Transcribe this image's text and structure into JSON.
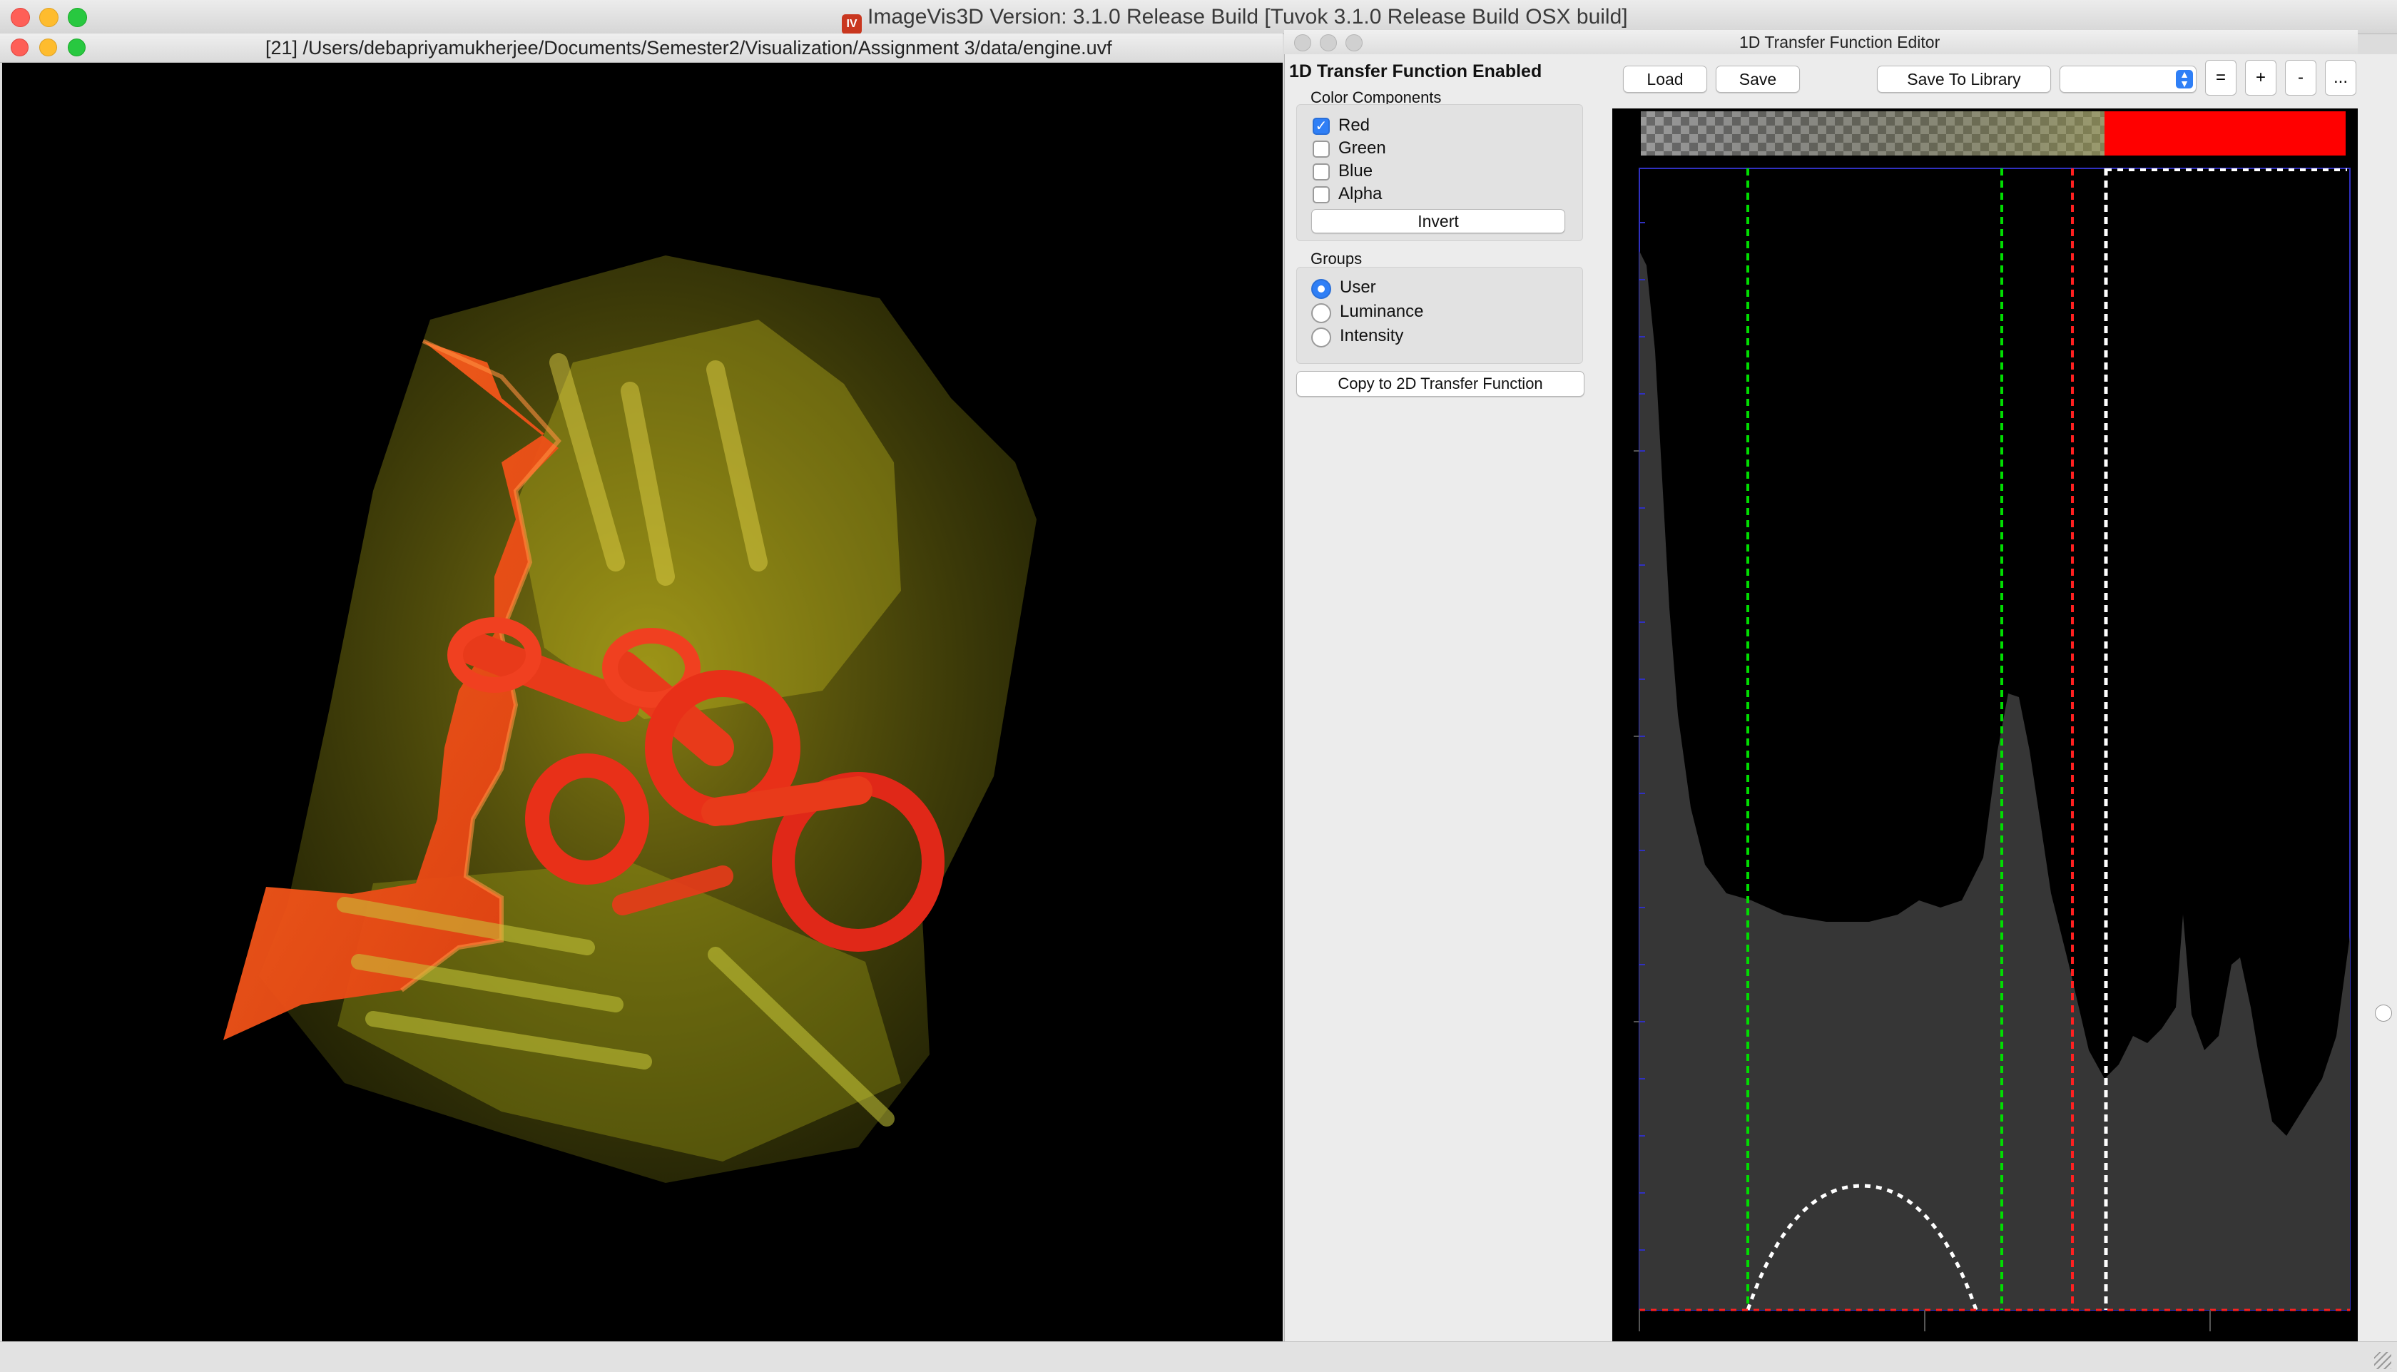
{
  "app": {
    "title": "ImageVis3D Version: 3.1.0 Release Build [Tuvok 3.1.0 Release Build OSX build]",
    "logo_text": "IV"
  },
  "render_window": {
    "title": "[21] /Users/debapriyamukherjee/Documents/Semester2/Visualization/Assignment 3/data/engine.uvf"
  },
  "editor_window": {
    "title": "1D Transfer Function Editor",
    "status": "1D Transfer Function Enabled",
    "color_components": {
      "heading": "Color Components",
      "items": [
        {
          "label": "Red",
          "checked": true
        },
        {
          "label": "Green",
          "checked": false
        },
        {
          "label": "Blue",
          "checked": false
        },
        {
          "label": "Alpha",
          "checked": false
        }
      ],
      "invert_label": "Invert"
    },
    "groups": {
      "heading": "Groups",
      "items": [
        {
          "label": "User",
          "selected": true
        },
        {
          "label": "Luminance",
          "selected": false
        },
        {
          "label": "Intensity",
          "selected": false
        }
      ]
    },
    "copy_label": "Copy to 2D Transfer Function",
    "toolbar": {
      "load_label": "Load",
      "save_label": "Save",
      "save_library_label": "Save To Library",
      "library_select_value": "",
      "equal_label": "=",
      "plus_label": "+",
      "minus_label": "-",
      "more_label": "..."
    }
  },
  "colors": {
    "accent": "#2f7ff6",
    "tf_red": "#ff0000",
    "histogram_fill": "#3a3a3a",
    "green_marker": "#00dd00",
    "red_marker": "#ff2020",
    "white_marker": "#ffffff"
  }
}
